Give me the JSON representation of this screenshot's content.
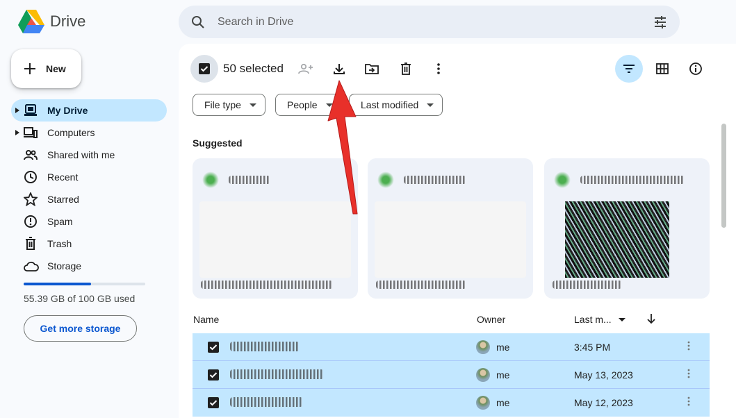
{
  "app": {
    "name": "Drive"
  },
  "search": {
    "placeholder": "Search in Drive"
  },
  "sidebar": {
    "new_label": "New",
    "items": [
      {
        "label": "My Drive",
        "icon": "my-drive-icon"
      },
      {
        "label": "Computers",
        "icon": "computers-icon"
      },
      {
        "label": "Shared with me",
        "icon": "shared-icon"
      },
      {
        "label": "Recent",
        "icon": "clock-icon"
      },
      {
        "label": "Starred",
        "icon": "star-icon"
      },
      {
        "label": "Spam",
        "icon": "spam-icon"
      },
      {
        "label": "Trash",
        "icon": "trash-icon"
      },
      {
        "label": "Storage",
        "icon": "cloud-icon"
      }
    ],
    "storage": {
      "used_text": "55.39 GB of 100 GB used",
      "used_fraction": 0.554
    },
    "get_storage_label": "Get more storage"
  },
  "toolbar": {
    "selected_text": "50 selected"
  },
  "filters": {
    "file_type": "File type",
    "people": "People",
    "last_modified": "Last modified"
  },
  "suggested": {
    "label": "Suggested"
  },
  "table": {
    "headers": {
      "name": "Name",
      "owner": "Owner",
      "modified": "Last m..."
    },
    "rows": [
      {
        "owner": "me",
        "modified": "3:45 PM"
      },
      {
        "owner": "me",
        "modified": "May 13, 2023"
      },
      {
        "owner": "me",
        "modified": "May 12, 2023"
      }
    ]
  },
  "colors": {
    "accent": "#0b57d0",
    "selected": "#c2e7ff",
    "annotation": "#e8302a"
  }
}
